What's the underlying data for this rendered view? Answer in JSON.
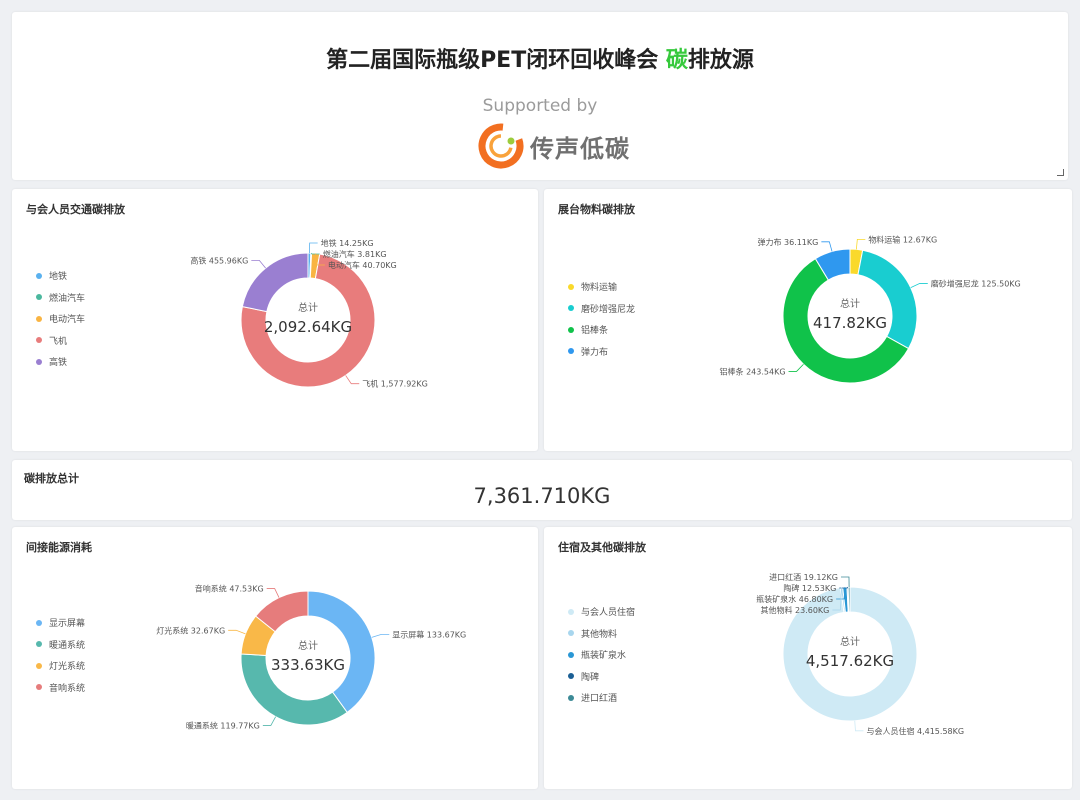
{
  "header": {
    "title_main": "第二届国际瓶级PET闭环回收峰会 ",
    "title_highlight": "碳",
    "title_tail": "排放源",
    "supported_by": "Supported by",
    "brand_name": "传声低碳"
  },
  "total": {
    "label": "碳排放总计",
    "value": "7,361.710KG"
  },
  "colors": {
    "accent_green": "#36c93c",
    "brand_orange": "#f26f21"
  },
  "chart_data": [
    {
      "type": "pie",
      "title": "与会人员交通碳排放",
      "center_label": "总计",
      "center_value": "2,092.64KG",
      "slices": [
        {
          "name": "地铁",
          "value": 14.25,
          "label": "14.25KG",
          "color": "#5ab1ef"
        },
        {
          "name": "燃油汽车",
          "value": 3.81,
          "label": "3.81KG",
          "color": "#4bb89e"
        },
        {
          "name": "电动汽车",
          "value": 40.7,
          "label": "40.70KG",
          "color": "#f9b442"
        },
        {
          "name": "飞机",
          "value": 1577.92,
          "label": "1,577.92KG",
          "color": "#e87c7c"
        },
        {
          "name": "高铁",
          "value": 455.96,
          "label": "455.96KG",
          "color": "#9a7fd1"
        }
      ]
    },
    {
      "type": "pie",
      "title": "展台物料碳排放",
      "center_label": "总计",
      "center_value": "417.82KG",
      "slices": [
        {
          "name": "物料运输",
          "value": 12.67,
          "label": "12.67KG",
          "color": "#fad92b"
        },
        {
          "name": "磨砂增强尼龙",
          "value": 125.5,
          "label": "125.50KG",
          "color": "#19cdd0"
        },
        {
          "name": "铝棒条",
          "value": 243.54,
          "label": "243.54KG",
          "color": "#10c24a"
        },
        {
          "name": "弹力布",
          "value": 36.11,
          "label": "36.11KG",
          "color": "#2f98ef"
        }
      ]
    },
    {
      "type": "pie",
      "title": "间接能源消耗",
      "center_label": "总计",
      "center_value": "333.63KG",
      "slices": [
        {
          "name": "显示屏幕",
          "value": 133.67,
          "label": "133.67KG",
          "color": "#6bb6f4"
        },
        {
          "name": "暖通系统",
          "value": 119.77,
          "label": "119.77KG",
          "color": "#57b8ad"
        },
        {
          "name": "灯光系统",
          "value": 32.67,
          "label": "32.67KG",
          "color": "#f9b848"
        },
        {
          "name": "音响系统",
          "value": 47.53,
          "label": "47.53KG",
          "color": "#e67c7c"
        }
      ]
    },
    {
      "type": "pie",
      "title": "住宿及其他碳排放",
      "center_label": "总计",
      "center_value": "4,517.62KG",
      "slices": [
        {
          "name": "与会人员住宿",
          "value": 4415.58,
          "label": "4,415.58KG",
          "color": "#cfeaf5"
        },
        {
          "name": "其他物料",
          "value": 23.6,
          "label": "23.60KG",
          "color": "#a8d6ee"
        },
        {
          "name": "瓶装矿泉水",
          "value": 46.8,
          "label": "46.80KG",
          "color": "#2a97d5"
        },
        {
          "name": "陶碑",
          "value": 12.53,
          "label": "12.53KG",
          "color": "#1b5f95"
        },
        {
          "name": "进口红酒",
          "value": 19.12,
          "label": "19.12KG",
          "color": "#3c8a96"
        }
      ]
    }
  ]
}
